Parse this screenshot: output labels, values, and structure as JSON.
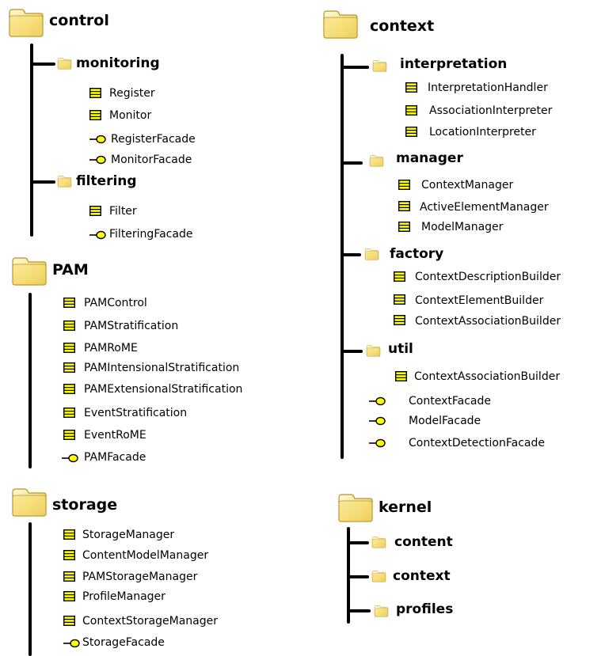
{
  "packages": {
    "control": {
      "title": "control",
      "monitoring": {
        "title": "monitoring",
        "items": [
          "Register",
          "Monitor",
          "RegisterFacade",
          "MonitorFacade"
        ]
      },
      "filtering": {
        "title": "filtering",
        "items": [
          "Filter",
          "FilteringFacade"
        ]
      }
    },
    "pam": {
      "title": "PAM",
      "items": [
        "PAMControl",
        "PAMStratification",
        "PAMRoME",
        "PAMIntensionalStratification",
        "PAMExtensionalStratification",
        "EventStratification",
        "EventRoME",
        "PAMFacade"
      ]
    },
    "storage": {
      "title": "storage",
      "items": [
        "StorageManager",
        "ContentModelManager",
        "PAMStorageManager",
        "ProfileManager",
        "ContextStorageManager",
        "StorageFacade"
      ]
    },
    "context": {
      "title": "context",
      "interpretation": {
        "title": "interpretation",
        "items": [
          "InterpretationHandler",
          "AssociationInterpreter",
          "LocationInterpreter"
        ]
      },
      "manager": {
        "title": "manager",
        "items": [
          "ContextManager",
          "ActiveElementManager",
          "ModelManager"
        ]
      },
      "factory": {
        "title": "factory",
        "items": [
          "ContextDescriptionBuilder",
          "ContextElementBuilder",
          "ContextAssociationBuilder"
        ]
      },
      "util": {
        "title": "util",
        "items": [
          "ContextAssociationBuilder"
        ]
      },
      "facades": [
        "ContextFacade",
        "ModelFacade",
        "ContextDetectionFacade"
      ]
    },
    "kernel": {
      "title": "kernel",
      "subpackages": [
        "content",
        "context",
        "profiles"
      ]
    }
  },
  "icons": {
    "package": "folder-icon",
    "class": "class-icon",
    "interface": "interface-lollipop-icon"
  },
  "colors": {
    "folder_fill": "#f6dc72",
    "folder_light": "#fdf3c0",
    "class_fill": "#ffff00",
    "interface_fill": "#ffff00",
    "line": "#000000"
  }
}
